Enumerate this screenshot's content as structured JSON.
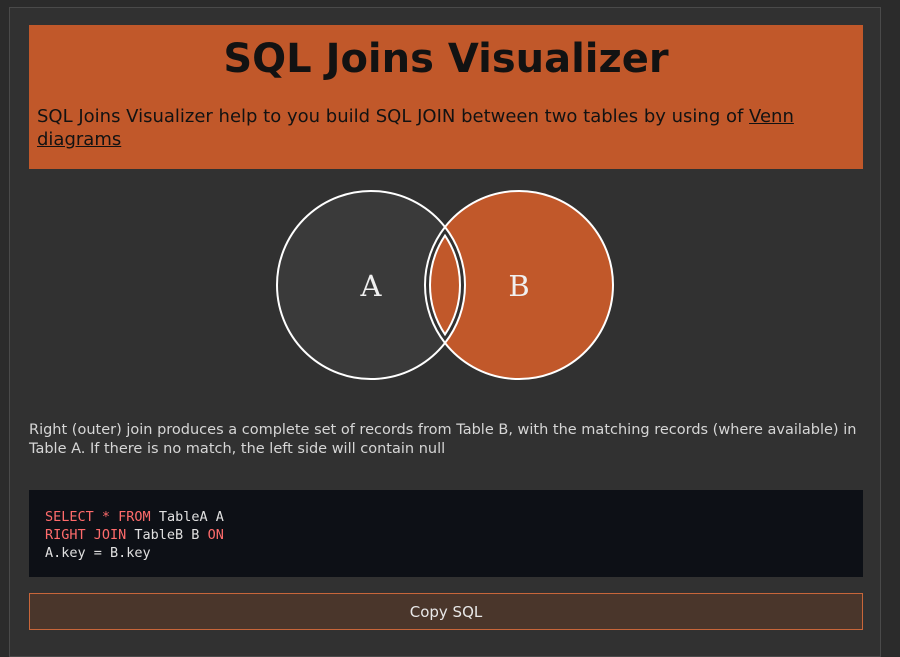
{
  "header": {
    "title": "SQL Joins Visualizer",
    "intro_text": "SQL Joins Visualizer help to you build SQL JOIN between two tables by using of ",
    "intro_link": "Venn diagrams"
  },
  "venn": {
    "left_label": "A",
    "right_label": "B",
    "left_selected": false,
    "middle_selected": true,
    "right_selected": true,
    "colors": {
      "unselected": "#3a3a3a",
      "selected": "#c1582a",
      "outline": "#ffffff"
    }
  },
  "description": "Right (outer) join produces a complete set of records from Table B, with the matching records (where available) in Table A. If there is no match, the left side will contain null",
  "sql": {
    "line1_kw1": "SELECT",
    "line1_op": " * ",
    "line1_kw2": "FROM",
    "line1_rest": " TableA A",
    "line2_kw1": "RIGHT JOIN",
    "line2_mid": " TableB B ",
    "line2_kw2": "ON",
    "line3": "A.key = B.key"
  },
  "copy_button": {
    "label": "Copy SQL"
  }
}
